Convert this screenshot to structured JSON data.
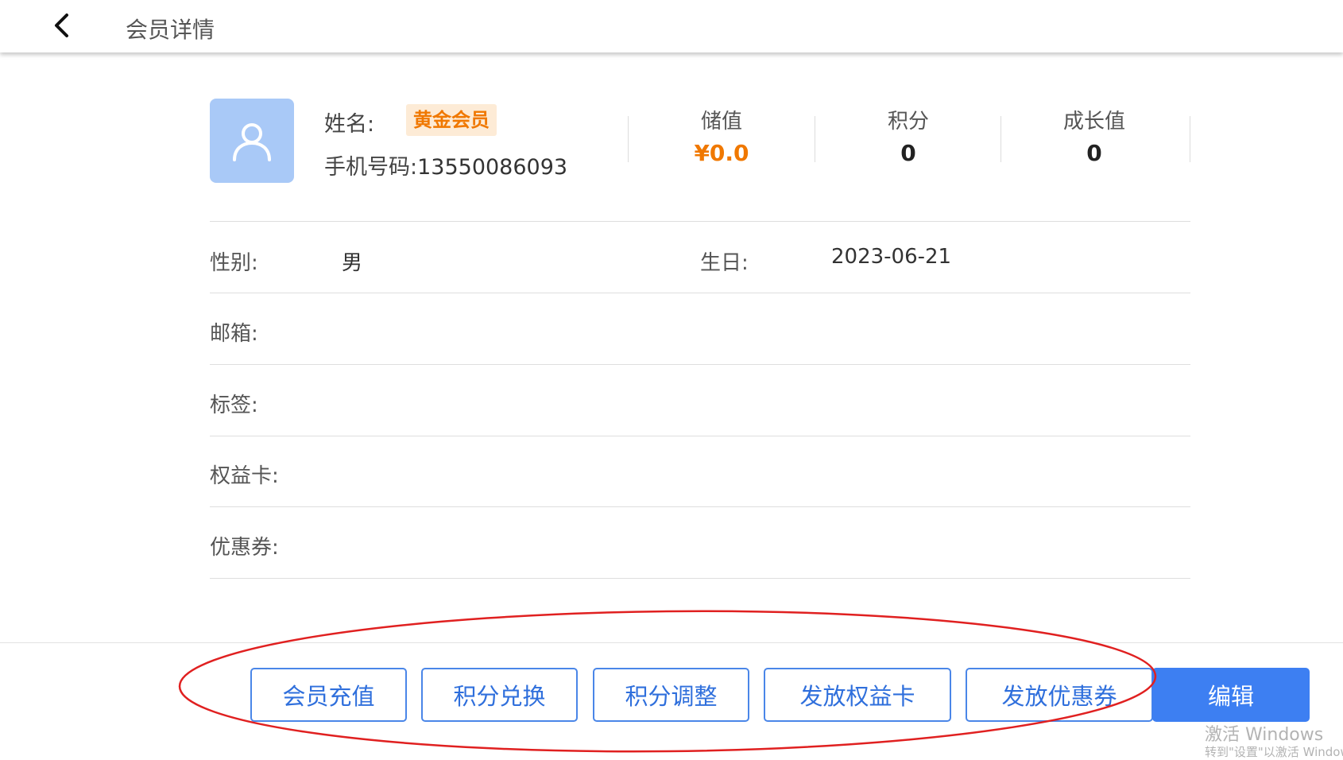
{
  "header": {
    "title": "会员详情"
  },
  "member": {
    "name_label": "姓名:",
    "level": "黄金会员",
    "phone_label": "手机号码:",
    "phone": "13550086093"
  },
  "stats": [
    {
      "label": "储值",
      "value": "¥0.0"
    },
    {
      "label": "积分",
      "value": "0"
    },
    {
      "label": "成长值",
      "value": "0"
    }
  ],
  "details": {
    "gender": {
      "label": "性别:",
      "value": "男"
    },
    "birthday": {
      "label": "生日:",
      "value": "2023-06-21"
    },
    "email": {
      "label": "邮箱:",
      "value": ""
    },
    "tags": {
      "label": "标签:",
      "value": ""
    },
    "benefit_card": {
      "label": "权益卡:",
      "value": ""
    },
    "coupon": {
      "label": "优惠券:",
      "value": ""
    }
  },
  "actions": {
    "recharge": "会员充值",
    "points_exchange": "积分兑换",
    "points_adjust": "积分调整",
    "issue_benefit_card": "发放权益卡",
    "issue_coupon": "发放优惠券",
    "edit": "编辑"
  },
  "watermark": {
    "line1": "激活 Windows",
    "line2": "转到\"设置\"以激活 Windows。"
  },
  "colors": {
    "accent": "#3d7ff2",
    "level_text": "#f07800",
    "level_bg": "#fdebd6",
    "avatar_bg": "#a9c9f7",
    "annotation": "#e02020"
  },
  "icons": {
    "back": "chevron-left-icon",
    "avatar": "user-icon"
  }
}
